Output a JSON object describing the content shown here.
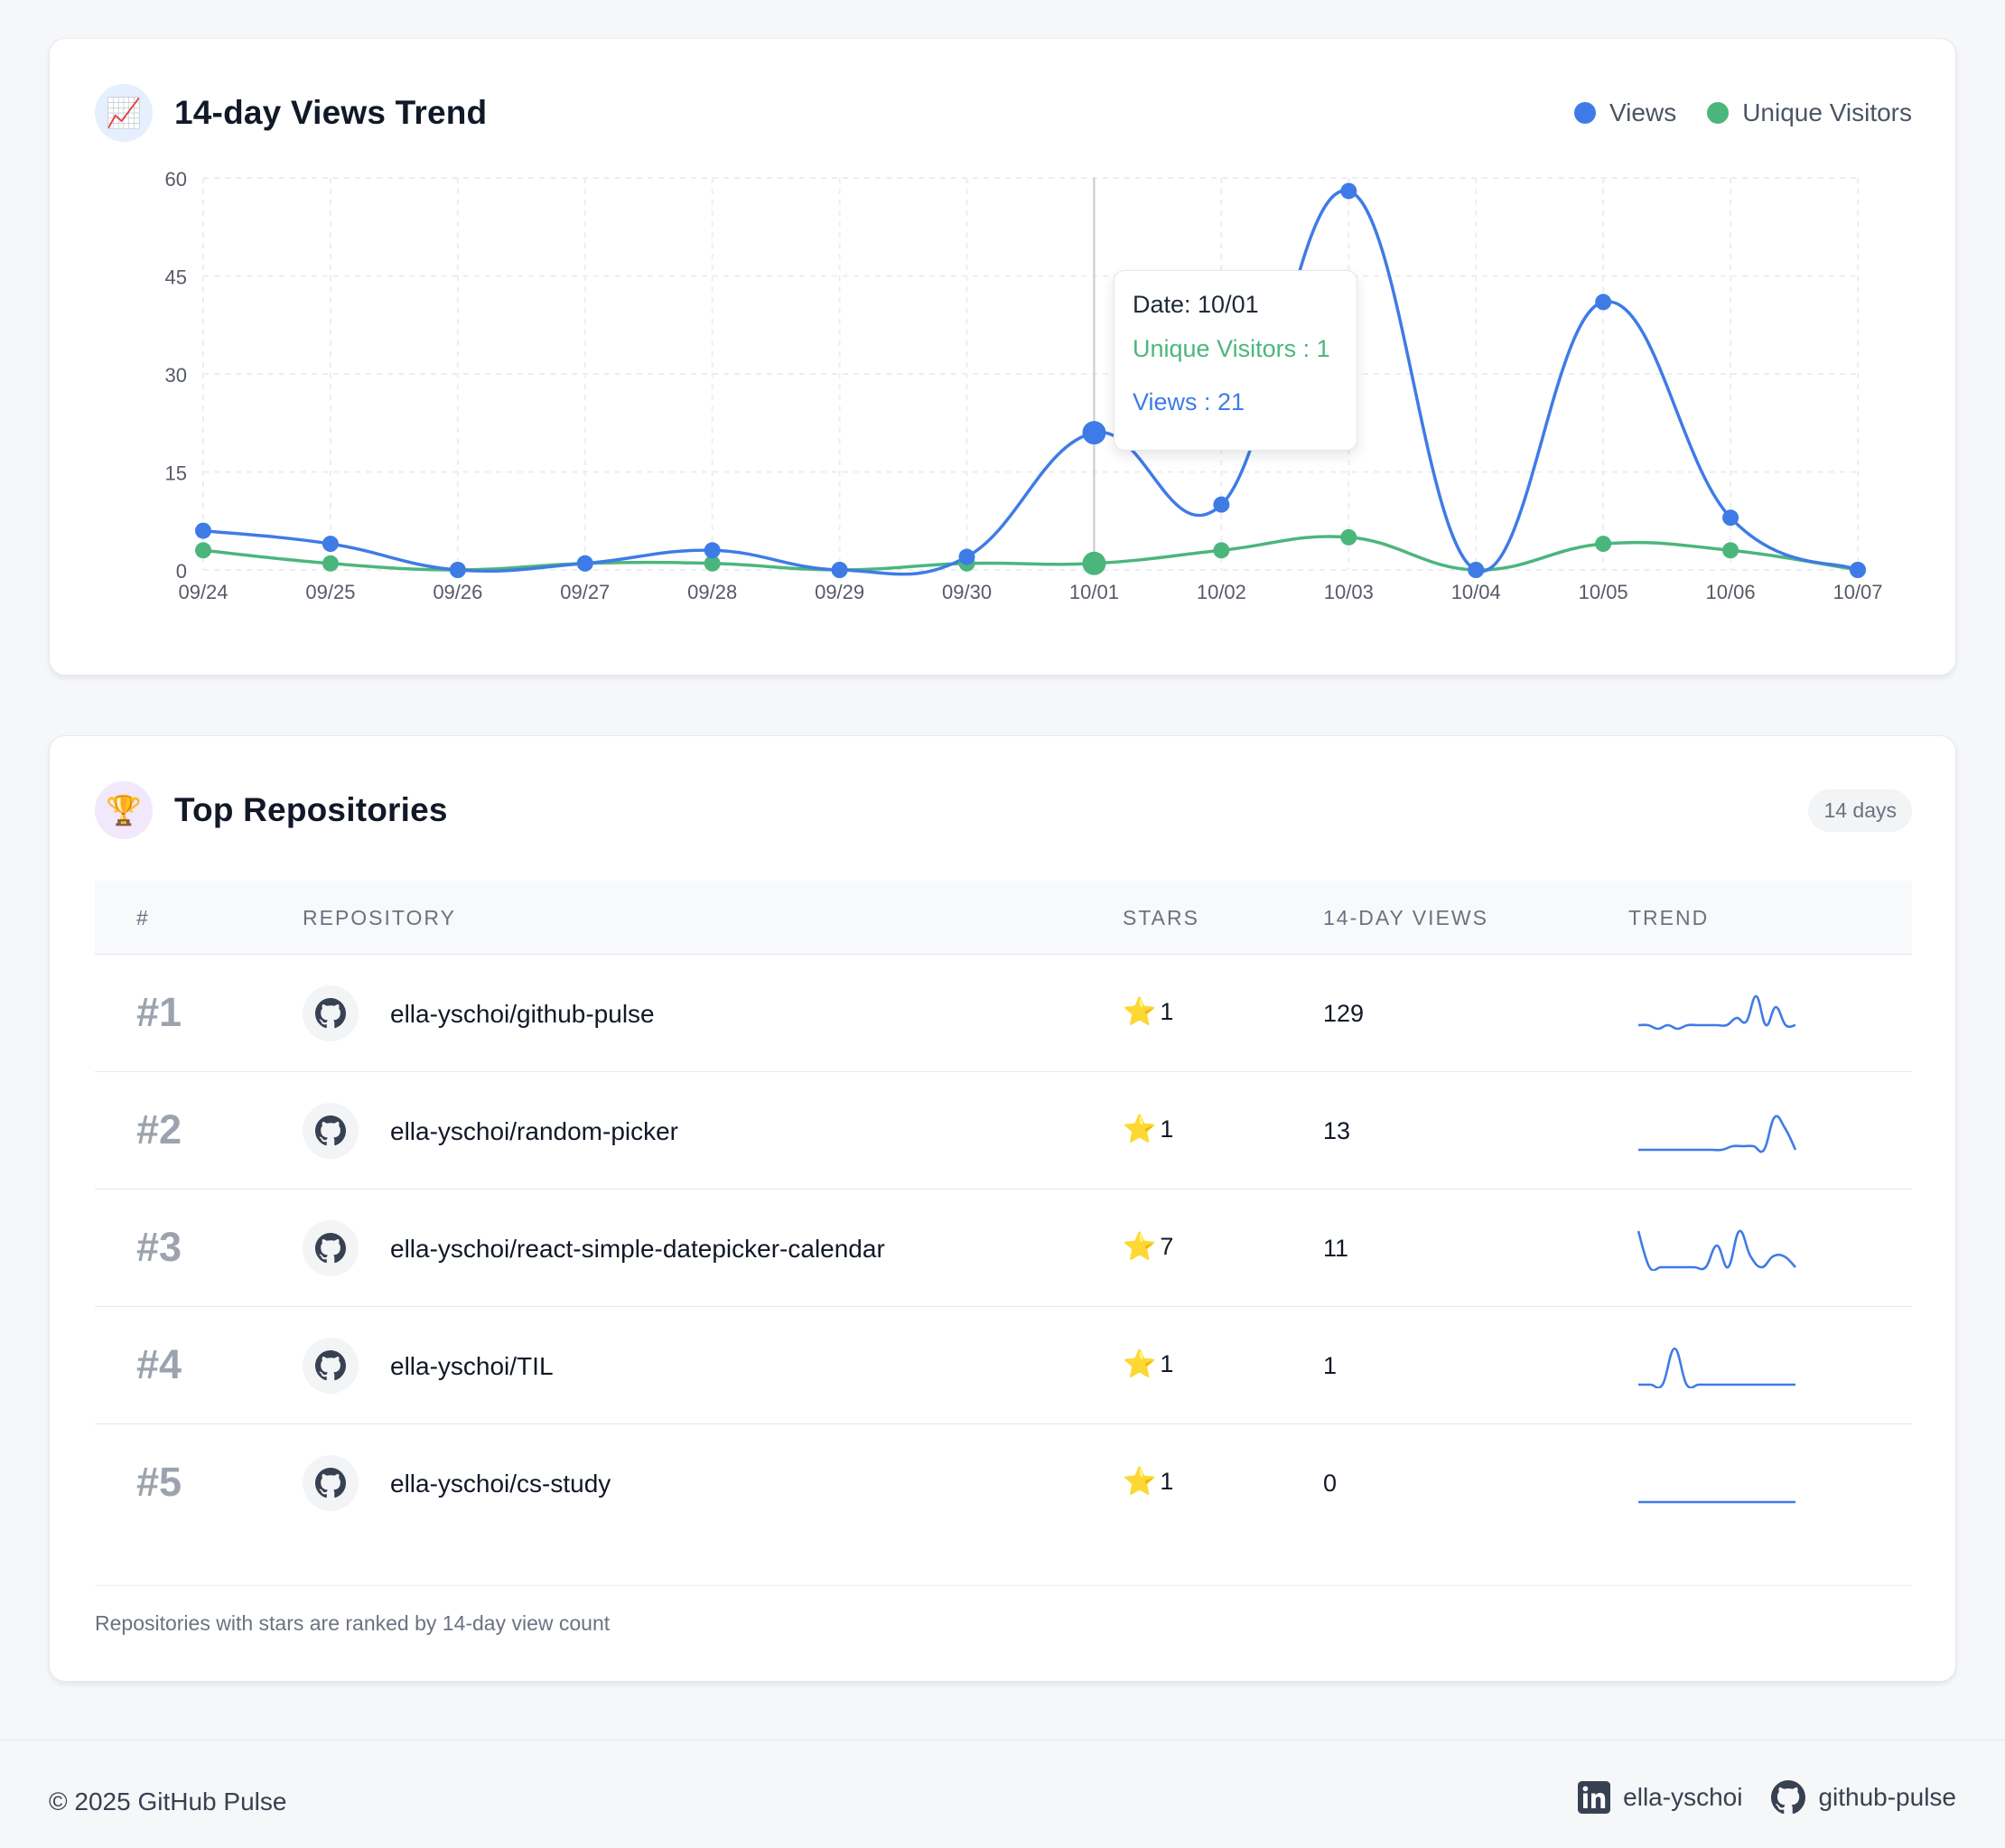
{
  "trend_card": {
    "icon": "chart-increasing-emoji",
    "icon_glyph": "📈",
    "title": "14-day Views Trend",
    "legend": [
      {
        "label": "Views",
        "color": "#3f7be6"
      },
      {
        "label": "Unique Visitors",
        "color": "#4bb67c"
      }
    ],
    "tooltip": {
      "date_text": "Date: 10/01",
      "unique_text": "Unique Visitors : 1",
      "views_text": "Views : 21"
    }
  },
  "chart_data": {
    "type": "line",
    "x": [
      "09/24",
      "09/25",
      "09/26",
      "09/27",
      "09/28",
      "09/29",
      "09/30",
      "10/01",
      "10/02",
      "10/03",
      "10/04",
      "10/05",
      "10/06",
      "10/07"
    ],
    "series": [
      {
        "name": "Views",
        "color": "#3f7be6",
        "values": [
          6,
          4,
          0,
          1,
          3,
          0,
          2,
          21,
          10,
          58,
          0,
          41,
          8,
          0
        ]
      },
      {
        "name": "Unique Visitors",
        "color": "#4bb67c",
        "values": [
          3,
          1,
          0,
          1,
          1,
          0,
          1,
          1,
          3,
          5,
          0,
          4,
          3,
          0
        ]
      }
    ],
    "yticks": [
      "0",
      "15",
      "30",
      "45",
      "60"
    ],
    "ylim": [
      0,
      60
    ],
    "grid": true,
    "highlight_index": 7,
    "legend_position": "top-right"
  },
  "repos_card": {
    "icon": "trophy-emoji",
    "icon_glyph": "🏆",
    "title": "Top Repositories",
    "period_badge": "14 days",
    "columns": [
      "#",
      "REPOSITORY",
      "STARS",
      "14-DAY VIEWS",
      "TREND"
    ],
    "rows": [
      {
        "rank": "#1",
        "repo": "ella-yschoi/github-pulse",
        "stars": "1",
        "views": "129",
        "trend": [
          0.2,
          0.2,
          0.1,
          0.2,
          0.1,
          0.2,
          0.2,
          0.2,
          0.2,
          0.2,
          0.4,
          0.3,
          1.0,
          0.2,
          0.7,
          0.2,
          0.2
        ]
      },
      {
        "rank": "#2",
        "repo": "ella-yschoi/random-picker",
        "stars": "1",
        "views": "13",
        "trend": [
          0,
          0,
          0,
          0,
          0,
          0,
          0,
          0,
          0,
          0.1,
          0.1,
          0.1,
          0,
          0.9,
          0.6,
          0
        ]
      },
      {
        "rank": "#3",
        "repo": "ella-yschoi/react-simple-datepicker-calendar",
        "stars": "7",
        "views": "11",
        "trend": [
          1.0,
          0,
          0,
          0,
          0,
          0,
          0,
          0.6,
          0,
          1.0,
          0.3,
          0,
          0.3,
          0.3,
          0
        ]
      },
      {
        "rank": "#4",
        "repo": "ella-yschoi/TIL",
        "stars": "1",
        "views": "1",
        "trend": [
          0,
          0,
          0,
          1.0,
          0,
          0,
          0,
          0,
          0,
          0,
          0,
          0,
          0,
          0
        ]
      },
      {
        "rank": "#5",
        "repo": "ella-yschoi/cs-study",
        "stars": "1",
        "views": "0",
        "trend": [
          0,
          0,
          0,
          0,
          0,
          0,
          0,
          0,
          0,
          0,
          0,
          0,
          0,
          0
        ]
      }
    ],
    "footer_note": "Repositories with stars are ranked by 14-day view count"
  },
  "footer": {
    "copyright": "© 2025 GitHub Pulse",
    "links": [
      {
        "icon": "linkedin-icon",
        "label": "ella-yschoi"
      },
      {
        "icon": "github-icon",
        "label": "github-pulse"
      }
    ]
  }
}
